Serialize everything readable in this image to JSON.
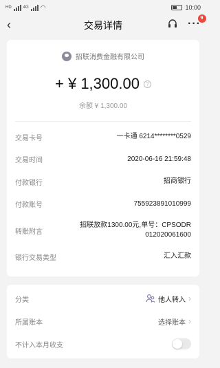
{
  "status_bar": {
    "time": "10:00",
    "left_tag_1": "HD",
    "left_tag_2": "4G"
  },
  "nav": {
    "title": "交易详情",
    "badge_count": "9"
  },
  "summary": {
    "merchant": "招联消费金融有限公司",
    "amount": "+ ¥ 1,300.00",
    "balance": "余额 ¥ 1,300.00"
  },
  "details": [
    {
      "label": "交易卡号",
      "value": "一卡通 6214********0529"
    },
    {
      "label": "交易时间",
      "value": "2020-06-16 21:59:48"
    },
    {
      "label": "付款银行",
      "value": "招商银行"
    },
    {
      "label": "付款账号",
      "value": "755923891010999"
    },
    {
      "label": "转账附言",
      "value": "招联放款1300.00元,单号：CPSODR\n012020061600"
    },
    {
      "label": "银行交易类型",
      "value": "汇入汇款"
    }
  ],
  "settings": {
    "category_label": "分类",
    "category_value": "他人转入",
    "book_label": "所属账本",
    "book_value": "选择账本",
    "exclude_label": "不计入本月收支"
  },
  "colors": {
    "badge": "#e84a3f",
    "background": "#f3f3f3"
  }
}
